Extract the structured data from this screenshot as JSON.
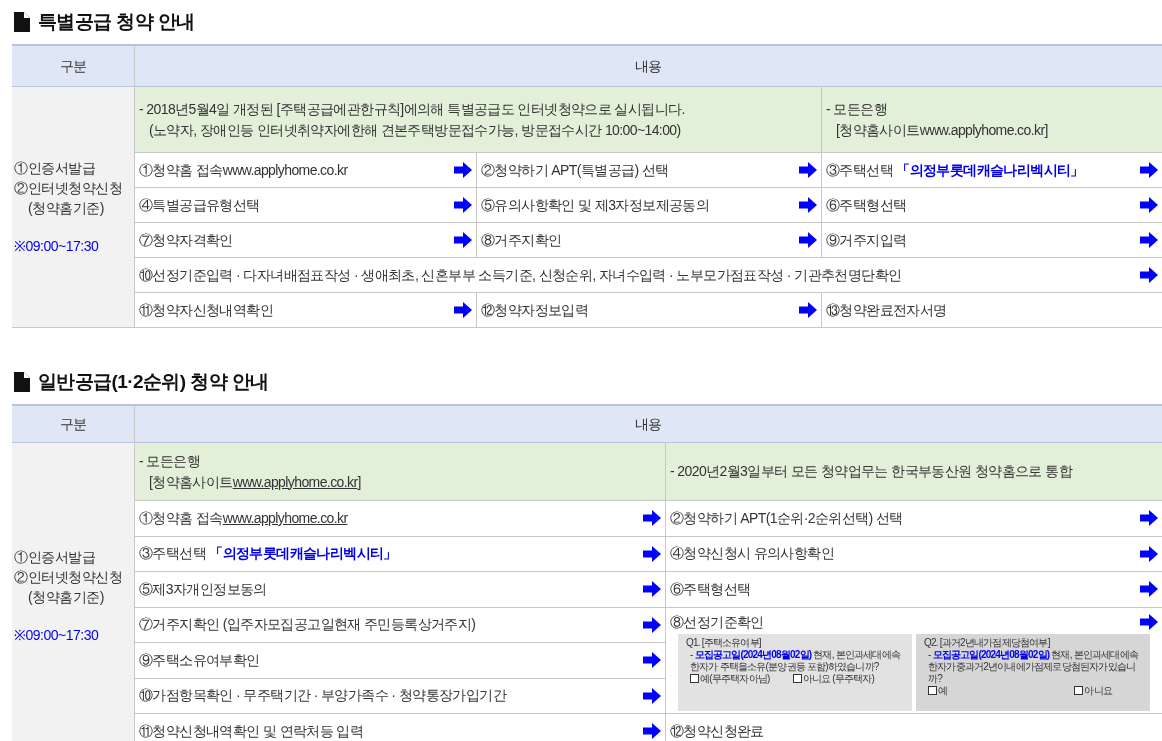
{
  "sections": [
    {
      "title": "특별공급 청약 안내",
      "header": {
        "category": "구분",
        "content": "내용"
      },
      "category": {
        "lines": [
          "①인증서발급",
          "②인터넷청약신청",
          "(청약홈기준)"
        ],
        "hours": "※09:00~17:30"
      },
      "notices": [
        {
          "lines": [
            "- 2018년5월4일 개정된 [주택공급에관한규칙]에의해 특별공급도 인터넷청약으로 실시됩니다.",
            "(노약자, 장애인등 인터넷취약자에한해 견본주택방문접수가능, 방문접수시간 10:00~14:00)"
          ]
        },
        {
          "lines": [
            "- 모든은행",
            "[청약홈사이트www.applyhome.co.kr]"
          ]
        }
      ],
      "rows": [
        [
          {
            "parts": [
              {
                "text": "①청약홈 접속www.applyhome.co.kr",
                "kind": "plain"
              }
            ],
            "arrow": true
          },
          {
            "parts": [
              {
                "text": "②청약하기 APT(특별공급) 선택",
                "kind": "plain"
              }
            ],
            "arrow": true
          },
          {
            "parts": [
              {
                "text": "③주택선택 ",
                "kind": "plain"
              },
              {
                "text": "「의정부롯데캐슬나리벡시티」",
                "kind": "highlight"
              }
            ],
            "arrow": true
          }
        ],
        [
          {
            "parts": [
              {
                "text": "④특별공급유형선택",
                "kind": "plain"
              }
            ],
            "arrow": true
          },
          {
            "parts": [
              {
                "text": "⑤유의사항확인 및 제3자정보제공동의",
                "kind": "plain"
              }
            ],
            "arrow": true
          },
          {
            "parts": [
              {
                "text": "⑥주택형선택",
                "kind": "plain"
              }
            ],
            "arrow": true
          }
        ],
        [
          {
            "parts": [
              {
                "text": "⑦청약자격확인",
                "kind": "plain"
              }
            ],
            "arrow": true
          },
          {
            "parts": [
              {
                "text": "⑧거주지확인",
                "kind": "plain"
              }
            ],
            "arrow": true
          },
          {
            "parts": [
              {
                "text": "⑨거주지입력",
                "kind": "plain"
              }
            ],
            "arrow": true
          }
        ],
        [
          {
            "parts": [
              {
                "text": "⑩선정기준입력 · 다자녀배점표작성 · 생애최초, 신혼부부 소득기준, 신청순위, 자녀수입력 · 노부모가점표작성 · 기관추천명단확인",
                "kind": "plain"
              }
            ],
            "arrow": true
          }
        ],
        [
          {
            "parts": [
              {
                "text": "⑪청약자신청내역확인",
                "kind": "plain"
              }
            ],
            "arrow": true
          },
          {
            "parts": [
              {
                "text": "⑫청약자정보입력",
                "kind": "plain"
              }
            ],
            "arrow": true
          },
          {
            "parts": [
              {
                "text": "⑬청약완료전자서명",
                "kind": "plain"
              }
            ],
            "arrow": false
          }
        ]
      ]
    },
    {
      "title": "일반공급(1·2순위) 청약 안내",
      "header": {
        "category": "구분",
        "content": "내용"
      },
      "category": {
        "lines": [
          "①인증서발급",
          "②인터넷청약신청",
          "(청약홈기준)"
        ],
        "hours": "※09:00~17:30"
      },
      "notices": [
        {
          "parts": [
            {
              "text": "- 모든은행",
              "kind": "plain"
            },
            {
              "text": "[청약홈사이트",
              "kind": "plain"
            },
            {
              "text": "www.applyhome.co.kr",
              "kind": "link"
            },
            {
              "text": "]",
              "kind": "plain"
            }
          ]
        },
        {
          "parts": [
            {
              "text": "- 2020년2월3일부터 모든 청약업무는 한국부동산원 청약홈으로 통합",
              "kind": "plain"
            }
          ]
        }
      ],
      "left_steps": [
        {
          "kind": "step",
          "parts": [
            {
              "text": "①청약홈 접속",
              "kind": "plain"
            },
            {
              "text": "www.applyhome.co.kr",
              "kind": "link"
            }
          ],
          "arrow": true
        },
        {
          "kind": "step",
          "parts": [
            {
              "text": "③주택선택 ",
              "kind": "plain"
            },
            {
              "text": "「의정부롯데캐슬나리벡시티」",
              "kind": "highlight"
            }
          ],
          "arrow": true
        },
        {
          "kind": "step",
          "parts": [
            {
              "text": "⑤제3자개인정보동의",
              "kind": "plain"
            }
          ],
          "arrow": true
        },
        {
          "kind": "step",
          "parts": [
            {
              "text": "⑦거주지확인 (입주자모집공고일현재 주민등록상거주지)",
              "kind": "plain"
            }
          ],
          "arrow": true
        },
        {
          "kind": "step",
          "parts": [
            {
              "text": "⑨주택소유여부확인",
              "kind": "plain"
            }
          ],
          "arrow": true
        },
        {
          "kind": "step",
          "parts": [
            {
              "text": "⑩가점항목확인 · 무주택기간 · 부양가족수 · 청약통장가입기간",
              "kind": "plain"
            }
          ],
          "arrow": true
        },
        {
          "kind": "step",
          "parts": [
            {
              "text": "⑪청약신청내역확인 및 연락처등 입력",
              "kind": "plain"
            }
          ],
          "arrow": true
        }
      ],
      "right_steps": [
        {
          "kind": "step",
          "parts": [
            {
              "text": "②청약하기 APT(1순위·2순위선택) 선택",
              "kind": "plain"
            }
          ],
          "arrow": true
        },
        {
          "kind": "step",
          "parts": [
            {
              "text": "④청약신청시 유의사항확인",
              "kind": "plain"
            }
          ],
          "arrow": true
        },
        {
          "kind": "step",
          "parts": [
            {
              "text": "⑥주택형선택",
              "kind": "plain"
            }
          ],
          "arrow": true
        },
        {
          "kind": "questions",
          "parts": [
            {
              "text": "⑧선정기준확인",
              "kind": "plain"
            }
          ],
          "arrow": true,
          "questions": [
            {
              "title": "Q1. [주택소유여부]",
              "dash": "- ",
              "date": "모집공고일(2024년08월02일)",
              "rest": " 현재, 본인과세대에속한자가 주택을소유(분양권등 포함)하였습니까?",
              "options": [
                {
                  "label": "예(무주택자아님)",
                  "checked": false
                },
                {
                  "label": "아니요 (무주택자)",
                  "checked": false
                }
              ]
            },
            {
              "title": "Q2. [과거2년내가점제당첨여부]",
              "dash": "- ",
              "date": "모집공고일(2024년08월02일)",
              "rest": " 현재, 본인과세대에속한자가중과거2년이내에가점제로당첨된자가있습니까?",
              "options": [
                {
                  "label": "예",
                  "checked": false
                },
                {
                  "label": "아니요",
                  "checked": false
                }
              ]
            }
          ]
        },
        {
          "kind": "step",
          "parts": [
            {
              "text": "⑫청약신청완료",
              "kind": "plain"
            }
          ],
          "arrow": false
        }
      ]
    }
  ]
}
